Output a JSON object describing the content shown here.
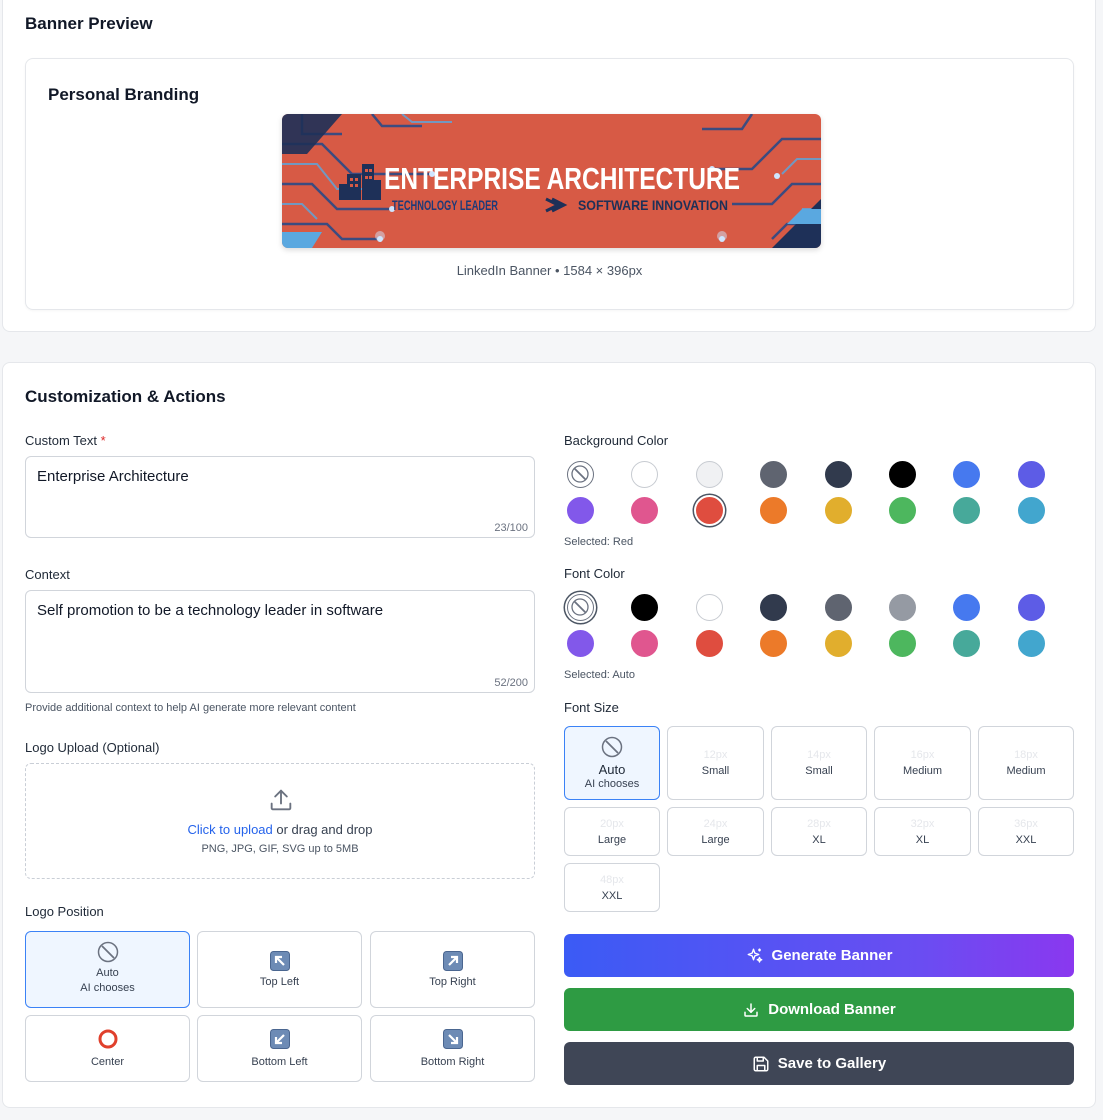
{
  "preview": {
    "title": "Banner Preview",
    "card_title": "Personal Branding",
    "banner": {
      "headline": "ENTERPRISE ARCHITECTURE",
      "left_tag": "TECHNOLOGY LEADER",
      "right_tag": "SOFTWARE INNOVATION",
      "background": "#d75a45"
    },
    "caption": "LinkedIn Banner • 1584 × 396px"
  },
  "custom": {
    "title": "Customization & Actions",
    "custom_text": {
      "label": "Custom Text",
      "required_mark": "*",
      "value": "Enterprise Architecture",
      "counter": "23/100"
    },
    "context": {
      "label": "Context",
      "value": "Self promotion to be a technology leader in software",
      "counter": "52/200",
      "helper": "Provide additional context to help AI generate more relevant content"
    },
    "logo_upload": {
      "label": "Logo Upload (Optional)",
      "link_text": "Click to upload",
      "rest_text": " or drag and drop",
      "formats": "PNG, JPG, GIF, SVG up to 5MB"
    },
    "logo_position": {
      "label": "Logo Position",
      "options": [
        {
          "label": "Auto",
          "sub": "AI chooses",
          "icon": "no-entry-icon",
          "selected": true
        },
        {
          "label": "Top Left",
          "icon": "arrow-up-left-icon"
        },
        {
          "label": "Top Right",
          "icon": "arrow-up-right-icon"
        },
        {
          "label": "Center",
          "icon": "circle-icon"
        },
        {
          "label": "Bottom Left",
          "icon": "arrow-down-left-icon"
        },
        {
          "label": "Bottom Right",
          "icon": "arrow-down-right-icon"
        }
      ]
    },
    "background_color": {
      "label": "Background Color",
      "selected_text": "Selected: Red",
      "swatches": [
        "none",
        "#ffffff",
        "#f0f1f3",
        "#5f6470",
        "#313a4d",
        "#000000",
        "#4679ef",
        "#5d5ce6",
        "#8258ea",
        "#e0568f",
        "#df4d3f",
        "#ec7a29",
        "#e1ae2d",
        "#4db75e",
        "#47a99a",
        "#42a6ce"
      ],
      "selected_index": 10
    },
    "font_color": {
      "label": "Font Color",
      "selected_text": "Selected: Auto",
      "swatches": [
        "none",
        "#000000",
        "#ffffff",
        "#313a4d",
        "#5f6470",
        "#959aa3",
        "#4679ef",
        "#5d5ce6",
        "#8258ea",
        "#e0568f",
        "#df4d3f",
        "#ec7a29",
        "#e1ae2d",
        "#4db75e",
        "#47a99a",
        "#42a6ce"
      ],
      "selected_index": 0
    },
    "font_size": {
      "label": "Font Size",
      "options": [
        {
          "px": "",
          "name": "Auto",
          "sub": "AI chooses",
          "selected": true
        },
        {
          "px": "12px",
          "name": "Small"
        },
        {
          "px": "14px",
          "name": "Small"
        },
        {
          "px": "16px",
          "name": "Medium"
        },
        {
          "px": "18px",
          "name": "Medium"
        },
        {
          "px": "20px",
          "name": "Large"
        },
        {
          "px": "24px",
          "name": "Large"
        },
        {
          "px": "28px",
          "name": "XL"
        },
        {
          "px": "32px",
          "name": "XL"
        },
        {
          "px": "36px",
          "name": "XXL"
        },
        {
          "px": "48px",
          "name": "XXL"
        }
      ]
    },
    "actions": {
      "generate": "Generate Banner",
      "download": "Download Banner",
      "save": "Save to Gallery"
    }
  }
}
